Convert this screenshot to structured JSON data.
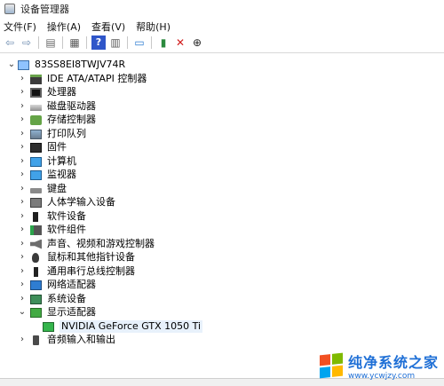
{
  "window": {
    "title": "设备管理器"
  },
  "menu": {
    "items": [
      "文件(F)",
      "操作(A)",
      "查看(V)",
      "帮助(H)"
    ]
  },
  "toolbar": {
    "icons": [
      "back-arrow",
      "forward-arrow",
      "show-hide-console-tree",
      "properties",
      "help",
      "action-pane",
      "monitor",
      "enable-device",
      "uninstall-device",
      "update-driver"
    ]
  },
  "tree": {
    "root": "83SS8EI8TWJV74R",
    "items": [
      {
        "label": "IDE ATA/ATAPI 控制器",
        "icon": "ide-controller-icon"
      },
      {
        "label": "处理器",
        "icon": "processor-icon"
      },
      {
        "label": "磁盘驱动器",
        "icon": "disk-drive-icon"
      },
      {
        "label": "存储控制器",
        "icon": "storage-controller-icon"
      },
      {
        "label": "打印队列",
        "icon": "print-queue-icon"
      },
      {
        "label": "固件",
        "icon": "firmware-icon"
      },
      {
        "label": "计算机",
        "icon": "computer-icon"
      },
      {
        "label": "监视器",
        "icon": "monitor-icon"
      },
      {
        "label": "键盘",
        "icon": "keyboard-icon"
      },
      {
        "label": "人体学输入设备",
        "icon": "hid-icon"
      },
      {
        "label": "软件设备",
        "icon": "software-device-icon"
      },
      {
        "label": "软件组件",
        "icon": "software-component-icon"
      },
      {
        "label": "声音、视频和游戏控制器",
        "icon": "audio-icon"
      },
      {
        "label": "鼠标和其他指针设备",
        "icon": "mouse-icon"
      },
      {
        "label": "通用串行总线控制器",
        "icon": "usb-icon"
      },
      {
        "label": "网络适配器",
        "icon": "network-adapter-icon"
      },
      {
        "label": "系统设备",
        "icon": "system-device-icon"
      },
      {
        "label": "显示适配器",
        "icon": "display-adapter-icon",
        "expanded": true
      },
      {
        "label": "音频输入和输出",
        "icon": "audio-io-icon"
      }
    ],
    "display_child": "NVIDIA GeForce GTX 1050 Ti"
  },
  "watermark": {
    "title": "纯净系统之家",
    "url": "www.ycwjzy.com"
  }
}
